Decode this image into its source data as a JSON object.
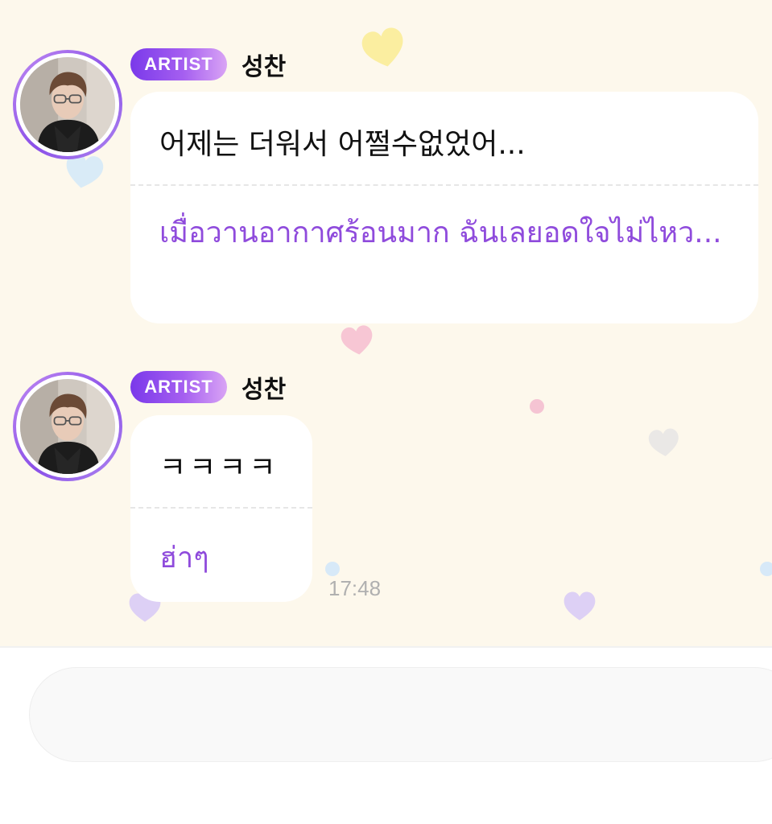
{
  "messages": [
    {
      "badge": "ARTIST",
      "sender": "성찬",
      "original": "어제는 더워서 어쩔수없었어...",
      "translation": "เมื่อวานอากาศร้อนมาก ฉันเลยอดใจไม่ไหว..."
    },
    {
      "badge": "ARTIST",
      "sender": "성찬",
      "original": "ㅋㅋㅋㅋ",
      "translation": "ฮ่าๆ",
      "time": "17:48"
    }
  ],
  "composer": {
    "placeholder": ""
  },
  "colors": {
    "chat_background": "#fdf8ec",
    "badge_gradient_start": "#7a39ea",
    "badge_gradient_end": "#d9a4f5",
    "translation_text": "#8f4bdc",
    "bubble": "#ffffff"
  },
  "icons": [
    "heart-icon",
    "avatar-photo"
  ]
}
